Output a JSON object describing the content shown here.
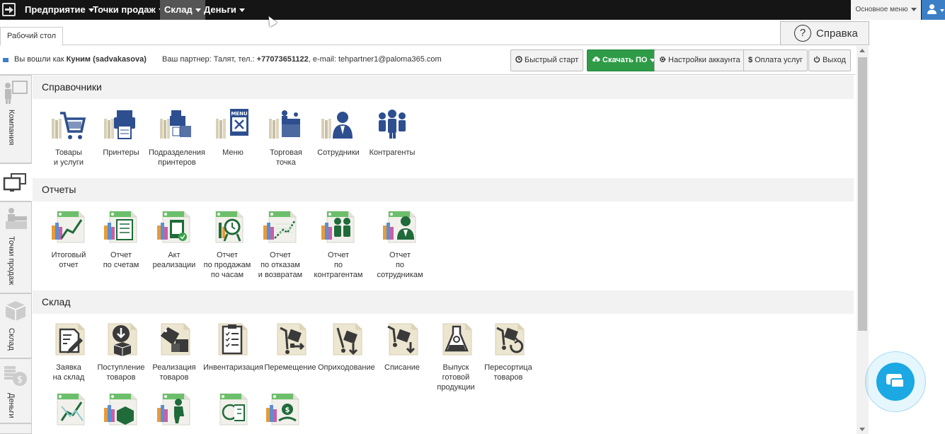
{
  "topnav": {
    "items": [
      "Предприятие",
      "Точки продаж",
      "Склад",
      "Деньги"
    ],
    "active_index": 2,
    "main_menu": "Основное меню"
  },
  "tabs": {
    "desktop": "Рабочий стол",
    "help": "Справка",
    "help_glyph": "?"
  },
  "info": {
    "logged_in_prefix": "Вы вошли как",
    "user": "Куним (sadvakasova)",
    "partner_prefix": "Ваш партнер: Талят, тел.:",
    "phone": "+77073651122",
    "email_text": ", e-mail: tehpartner1@paloma365.com"
  },
  "toolbar": {
    "quick_start": "Быстрый старт",
    "download": "Скачать ПО",
    "account_settings": "Настройки аккаунта",
    "payment": "Оплата услуг",
    "logout": "Выход",
    "payment_glyph": "$"
  },
  "sidebar": [
    "Компания",
    "",
    "Точки продаж",
    "Склад",
    "Деньги"
  ],
  "sections": {
    "refs": "Справочники",
    "reports": "Отчеты",
    "warehouse": "Склад"
  },
  "refs_tiles": [
    "Товары\nи услуги",
    "Принтеры",
    "Подразделения\nпринтеров",
    "Меню",
    "Торговая\nточка",
    "Сотрудники",
    "Контрагенты"
  ],
  "reports_tiles": [
    "Итоговый\nотчет",
    "Отчет\nпо счетам",
    "Акт\nреализации",
    "Отчет\nпо продажам\nпо часам",
    "Отчет\nпо отказам\nи возвратам",
    "Отчет\nпо контрагентам",
    "Отчет\nпо сотрудникам"
  ],
  "warehouse_tiles": [
    "Заявка\nна склад",
    "Поступление\nтоваров",
    "Реализация\nтоваров",
    "Инвентаризация",
    "Перемещение",
    "Оприходование",
    "Списание",
    "Выпуск\nготовой\nпродукции",
    "Пересортица\nтоваров"
  ],
  "menu_icon_text": "MENU",
  "colors": {
    "nav_bg": "#151515",
    "brand_blue": "#3c7fc6",
    "green": "#2e9b46",
    "icon_navy": "#2d4f8f",
    "chat": "#1ba8e3"
  }
}
